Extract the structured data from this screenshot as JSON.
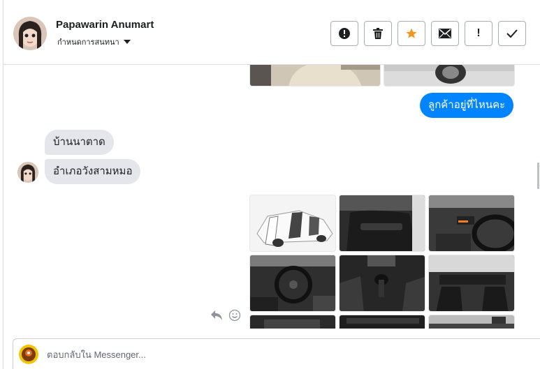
{
  "header": {
    "contact_name": "Papawarin Anumart",
    "subtitle": "กำหนดการสนทนา",
    "avatar_icon": "profile-photo",
    "actions": [
      {
        "name": "spam-button",
        "icon": "exclamation-circle-icon",
        "glyph": "●"
      },
      {
        "name": "delete-button",
        "icon": "trash-icon",
        "glyph": ""
      },
      {
        "name": "star-button",
        "icon": "star-icon",
        "glyph": "★",
        "color": "#f7931e"
      },
      {
        "name": "mark-unread-button",
        "icon": "envelope-icon",
        "glyph": ""
      },
      {
        "name": "follow-up-button",
        "icon": "exclamation-icon",
        "glyph": "!"
      },
      {
        "name": "done-button",
        "icon": "check-icon",
        "glyph": ""
      }
    ]
  },
  "messages": {
    "outgoing_1": "ลูกค้าอยู่ที่ไหนคะ",
    "incoming_1": "บ้านนาตาด",
    "incoming_2": "อำเภอวังสามหมอ",
    "accent_color": "#0084ff",
    "incoming_bubble_color": "#e4e6eb"
  },
  "attachments": {
    "top_row": [
      "car-interior-seat-photo",
      "car-exterior-wheel-photo"
    ],
    "grid": [
      "white-car-open-doors-photo",
      "door-panel-interior-photo",
      "dashboard-console-photo",
      "steering-wheel-dashboard-photo",
      "gear-shifter-photo",
      "front-seats-interior-photo",
      "engine-bay-photo",
      "dark-interior-detail-photo",
      "interior-roof-photo"
    ]
  },
  "reply_actions": {
    "reply_icon": "reply-arrow-icon",
    "emoji_icon": "smiley-icon"
  },
  "composer": {
    "placeholder": "ตอบกลับใน Messenger...",
    "avatar_icon": "page-avatar"
  }
}
